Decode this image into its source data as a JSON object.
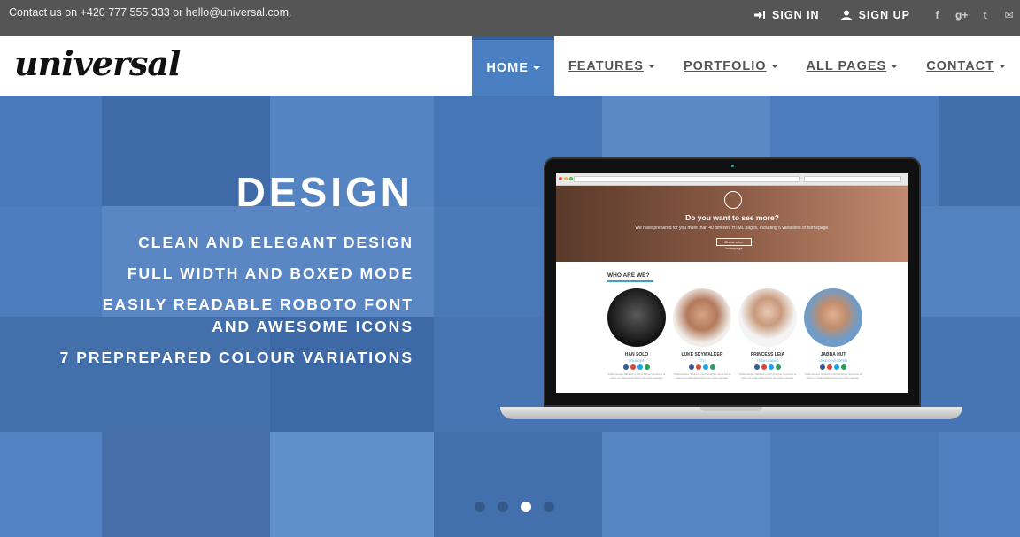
{
  "topbar": {
    "contact": "Contact us on +420 777 555 333 or hello@universal.com.",
    "sign_in": "SIGN IN",
    "sign_up": "SIGN UP",
    "social": [
      {
        "icon": "facebook-icon",
        "glyph": "f"
      },
      {
        "icon": "google-plus-icon",
        "glyph": "g+"
      },
      {
        "icon": "twitter-icon",
        "glyph": "t"
      },
      {
        "icon": "email-icon",
        "glyph": "✉"
      }
    ]
  },
  "brand": {
    "logo": "universal"
  },
  "nav": {
    "items": [
      {
        "label": "HOME",
        "active": true
      },
      {
        "label": "FEATURES",
        "active": false
      },
      {
        "label": "PORTFOLIO",
        "active": false
      },
      {
        "label": "ALL PAGES",
        "active": false
      },
      {
        "label": "CONTACT",
        "active": false
      }
    ]
  },
  "hero": {
    "title": "DESIGN",
    "features": [
      "CLEAN AND ELEGANT DESIGN",
      "FULL WIDTH AND BOXED MODE",
      "EASILY READABLE ROBOTO FONT AND AWESOME ICONS",
      "7 PREPREPARED COLOUR VARIATIONS"
    ]
  },
  "mockup": {
    "headline": "Do you want to see more?",
    "subtext": "We have prepared for you more than 40 different HTML pages, including 5 variations of homepage.",
    "button": "Check other homepage",
    "section_title": "WHO ARE WE?",
    "people": [
      {
        "name": "HAN SOLO",
        "role": "FOUNDER"
      },
      {
        "name": "LUKE SKYWALKER",
        "role": "CTO"
      },
      {
        "name": "PRINCESS LEIA",
        "role": "TEAM LEADER"
      },
      {
        "name": "JABBA HUT",
        "role": "LEAD DEVELOPER"
      }
    ],
    "blurb": "Pellentesque habitant morbi tristique senectus et netus et malesuada fames ac turpis egestas."
  },
  "slider": {
    "slide_count": 4,
    "active_index": 2
  },
  "colors": {
    "topbar": "#555555",
    "accent": "#4a7fc2",
    "hero": "#4777b8"
  }
}
